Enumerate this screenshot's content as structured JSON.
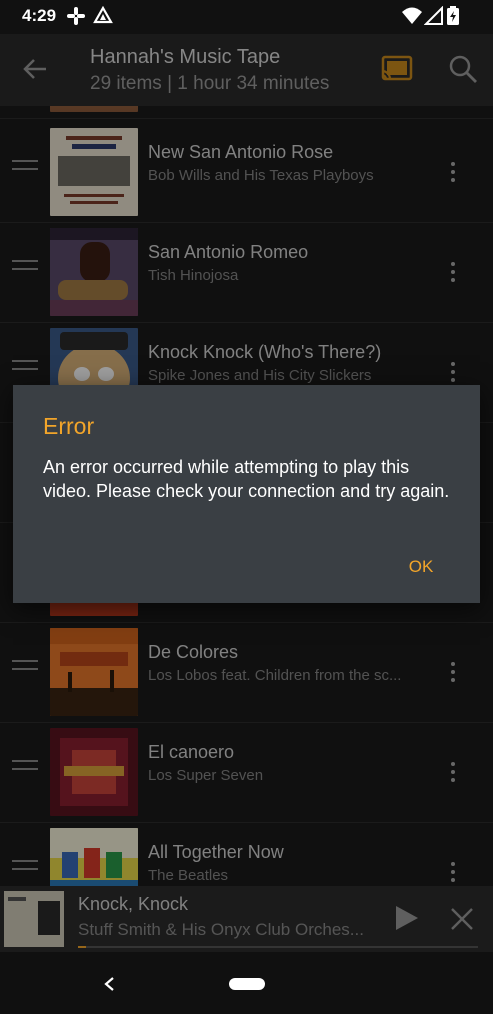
{
  "status_bar": {
    "time": "4:29",
    "icons": [
      "slack-icon",
      "drive-icon",
      "wifi-icon",
      "signal-icon",
      "battery-charging-icon"
    ]
  },
  "app_bar": {
    "title": "Hannah's Music Tape",
    "subtitle": "29 items | 1 hour 34 minutes",
    "icons": [
      "back-arrow-icon",
      "cast-icon",
      "search-icon"
    ],
    "accent_color": "#f2a52a"
  },
  "tracks": [
    {
      "title": "New San Antonio Rose",
      "artist": "Bob Wills and His Texas Playboys"
    },
    {
      "title": "San Antonio Romeo",
      "artist": "Tish Hinojosa"
    },
    {
      "title": "Knock Knock (Who's There?)",
      "artist": "Spike Jones and His City Slickers"
    },
    {
      "title": "De Colores",
      "artist": "Los Lobos feat. Children from the sc..."
    },
    {
      "title": "El canoero",
      "artist": "Los Super Seven"
    },
    {
      "title": "All Together Now",
      "artist": "The Beatles"
    }
  ],
  "dialog": {
    "title": "Error",
    "message": "An error occurred while attempting to play this video. Please check your connection and try again.",
    "ok_label": "OK"
  },
  "now_playing": {
    "title": "Knock, Knock",
    "artist": "Stuff Smith & His Onyx Club Orches...",
    "progress_fraction": 0.02
  },
  "nav_bar": {
    "icons": [
      "nav-back-icon",
      "home-pill-icon"
    ]
  }
}
